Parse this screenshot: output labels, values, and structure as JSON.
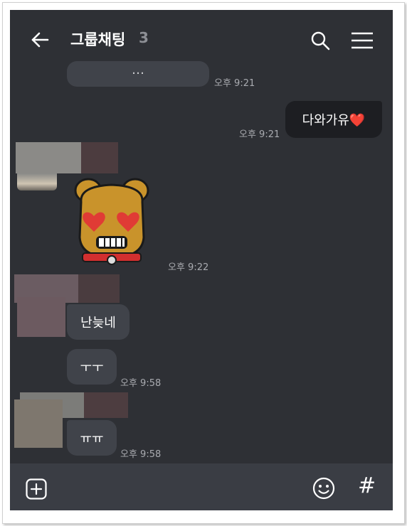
{
  "header": {
    "title": "그룹채팅",
    "member_count": "3"
  },
  "messages": [
    {
      "sender": "other",
      "text": "…",
      "time": "오후 9:21"
    },
    {
      "sender": "me",
      "text": "다와가유❤️",
      "time": "오후 9:21"
    },
    {
      "sender": "other",
      "type": "sticker",
      "sticker": "heart-eyes-dog",
      "time": "오후 9:22"
    },
    {
      "sender": "other",
      "text": "난늦네",
      "time": ""
    },
    {
      "sender": "other",
      "text": "ㅜㅜ",
      "time": "오후 9:58"
    },
    {
      "sender": "other",
      "text": "ㅠㅠ",
      "time": "오후 9:58"
    }
  ],
  "input_bar": {
    "icons": [
      "plus-icon",
      "emoji-icon",
      "hash-icon"
    ],
    "hash_label": "#"
  },
  "colors": {
    "background": "#2e3035",
    "other_bubble": "#40434a",
    "my_bubble": "#1d1e22",
    "input_bar": "#3a3d44"
  }
}
